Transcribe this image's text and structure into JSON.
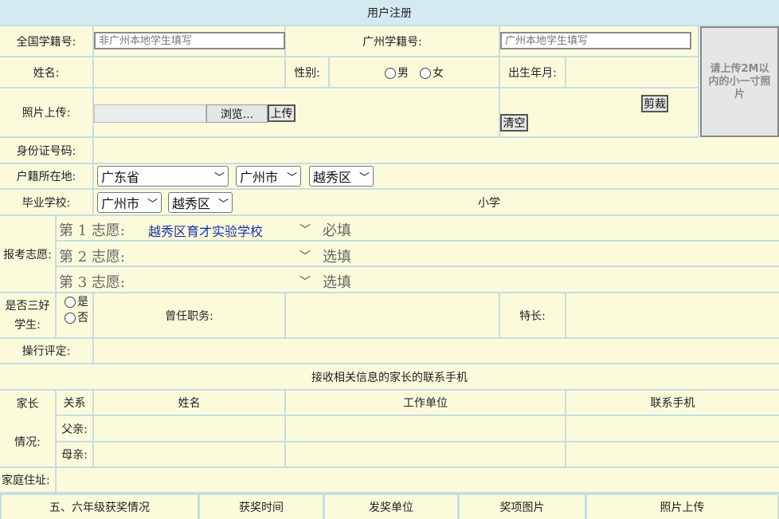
{
  "title": "用户注册",
  "labels": {
    "national_id": "全国学籍号:",
    "gz_id": "广州学籍号:",
    "name": "姓名:",
    "gender": "性别:",
    "male": "男",
    "female": "女",
    "birth": "出生年月:",
    "photo": "照片上传:",
    "idcard": "身份证号码:",
    "hukou": "户籍所在地:",
    "school": "毕业学校:",
    "school_level": "小学",
    "wishes": "报考志愿:",
    "sanhao_1": "是否三好",
    "sanhao_2": "学生:",
    "yes": "是",
    "no": "否",
    "duty": "曾任职务:",
    "talent": "特长:",
    "conduct": "操行评定:",
    "parent_section": "接收相关信息的家长的联系手机",
    "parent_1": "家长",
    "parent_2": "情况:",
    "relation": "关系",
    "pname": "姓名",
    "work": "工作单位",
    "phone": "联系手机",
    "father": "父亲:",
    "mother": "母亲:",
    "address": "家庭住址:"
  },
  "placeholders": {
    "national_id": "非广州本地学生填写",
    "gz_id": "广州本地学生填写"
  },
  "buttons": {
    "browse": "浏览...",
    "upload": "上传",
    "crop": "剪裁",
    "clear": "清空"
  },
  "photo_hint": "请上传2M以内的小一寸照片",
  "hukou": {
    "province": "广东省",
    "city": "广州市",
    "district": "越秀区"
  },
  "school": {
    "city": "广州市",
    "district": "越秀区"
  },
  "wishes": [
    {
      "label": "第 1 志愿:",
      "value": "越秀区育才实验学校",
      "req": "必填"
    },
    {
      "label": "第 2 志愿:",
      "value": "",
      "req": "选填"
    },
    {
      "label": "第 3 志愿:",
      "value": "",
      "req": "选填"
    }
  ],
  "awards_header": [
    "五、六年级获奖情况",
    "获奖时间",
    "发奖单位",
    "奖项图片",
    "照片上传"
  ]
}
